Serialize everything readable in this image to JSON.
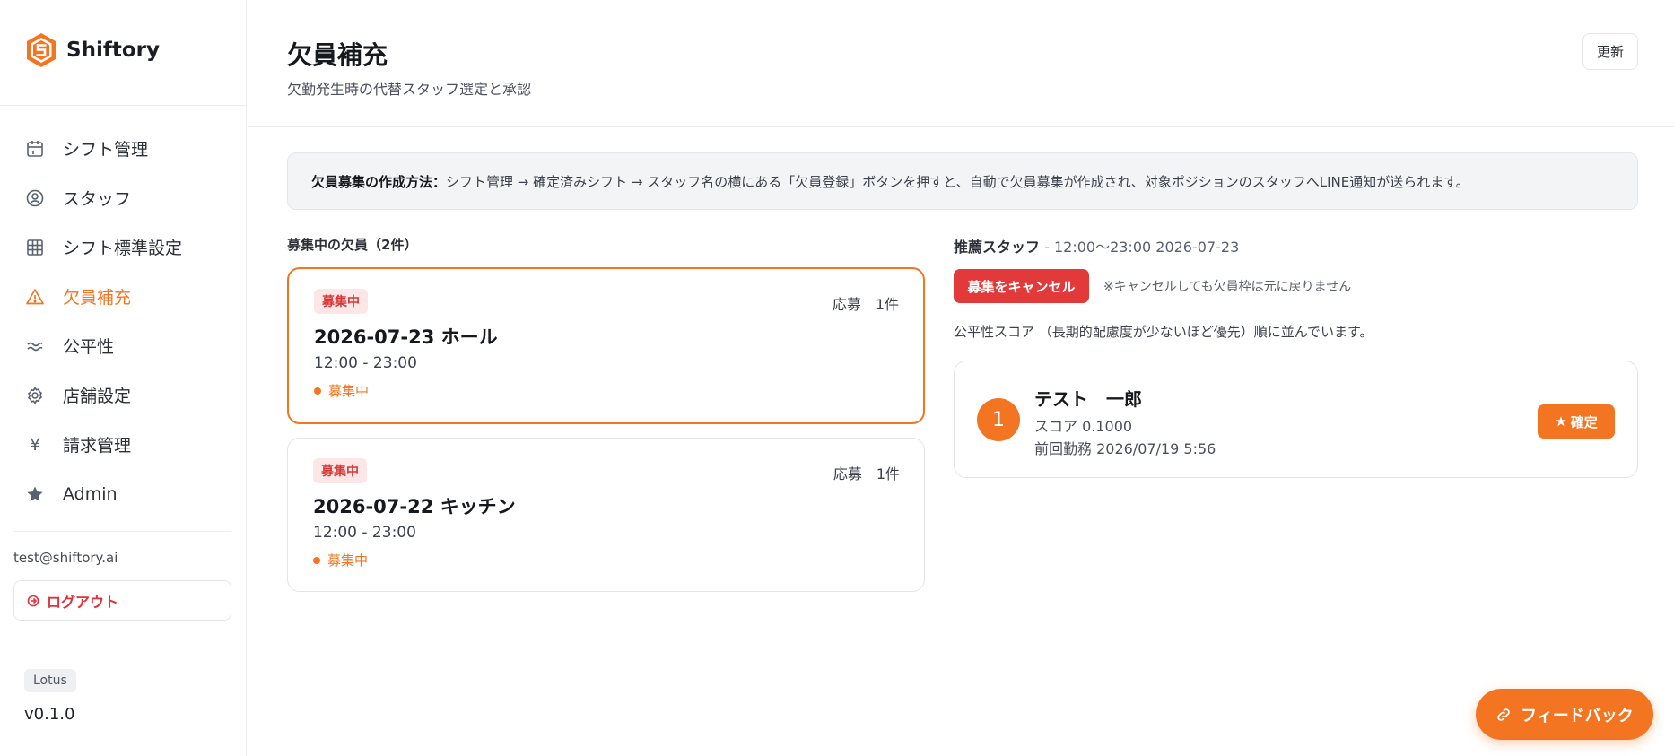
{
  "app": {
    "name": "Shiftory"
  },
  "sidebar": {
    "items": [
      {
        "label": "シフト管理",
        "icon": "calendar-icon",
        "active": false
      },
      {
        "label": "スタッフ",
        "icon": "staff-icon",
        "active": false
      },
      {
        "label": "シフト標準設定",
        "icon": "grid-icon",
        "active": false
      },
      {
        "label": "欠員補充",
        "icon": "warning-icon",
        "active": true
      },
      {
        "label": "公平性",
        "icon": "wave-icon",
        "active": false
      },
      {
        "label": "店舗設定",
        "icon": "gear-icon",
        "active": false
      },
      {
        "label": "請求管理",
        "icon": "yen-icon",
        "active": false
      },
      {
        "label": "Admin",
        "icon": "star-icon",
        "active": false
      }
    ],
    "user_email": "test@shiftory.ai",
    "logout_label": "ログアウト",
    "env_badge": "Lotus",
    "version": "v0.1.0"
  },
  "header": {
    "title": "欠員補充",
    "subtitle": "欠勤発生時の代替スタッフ選定と承認",
    "refresh_label": "更新"
  },
  "info": {
    "bold": "欠員募集の作成方法：",
    "text": "シフト管理 → 確定済みシフト → スタッフ名の横にある「欠員登録」ボタンを押すと、自動で欠員募集が作成され、対象ポジションのスタッフへLINE通知が送られます。"
  },
  "vacancies": {
    "section_label": "募集中の欠員（2件）",
    "items": [
      {
        "badge": "募集中",
        "applications": "応募　1件",
        "title": "2026-07-23 ホール",
        "time": "12:00 - 23:00",
        "status": "募集中",
        "selected": true
      },
      {
        "badge": "募集中",
        "applications": "応募　1件",
        "title": "2026-07-22 キッチン",
        "time": "12:00 - 23:00",
        "status": "募集中",
        "selected": false
      }
    ]
  },
  "recommend": {
    "label": "推薦スタッフ",
    "detail": " - 12:00〜23:00 2026-07-23",
    "cancel_label": "募集をキャンセル",
    "cancel_note": "※キャンセルしても欠員枠は元に戻りません",
    "rank_note": "公平性スコア （長期的配慮度が少ないほど優先）順に並んでいます。",
    "staff": [
      {
        "rank": "1",
        "name": "テスト　一郎",
        "score": "スコア 0.1000",
        "last_work": "前回勤務 2026/07/19 5:56",
        "confirm_label": "確定"
      }
    ]
  },
  "feedback_label": "フィードバック",
  "colors": {
    "accent": "#f47521",
    "danger": "#e23a3a"
  }
}
